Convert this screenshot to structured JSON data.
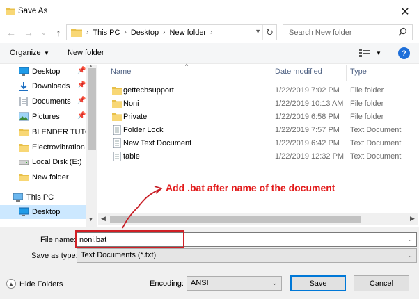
{
  "window": {
    "title": "Save As",
    "close_glyph": "✕"
  },
  "nav": {
    "back_glyph": "←",
    "forward_glyph": "→",
    "recent_glyph": "⌄",
    "up_glyph": "↑",
    "breadcrumb": [
      "This PC",
      "Desktop",
      "New folder"
    ],
    "refresh_glyph": "↻"
  },
  "search": {
    "placeholder": "Search New folder"
  },
  "toolbar": {
    "organize_label": "Organize",
    "new_folder_label": "New folder",
    "help_glyph": "?"
  },
  "sidebar": {
    "items": [
      {
        "label": "Desktop",
        "icon": "desktop-icon",
        "pinned": true
      },
      {
        "label": "Downloads",
        "icon": "download-icon",
        "pinned": true
      },
      {
        "label": "Documents",
        "icon": "document-icon",
        "pinned": true
      },
      {
        "label": "Pictures",
        "icon": "pictures-icon",
        "pinned": true
      },
      {
        "label": "BLENDER TUTOR",
        "icon": "folder-icon",
        "pinned": false
      },
      {
        "label": "Electrovibration",
        "icon": "folder-icon",
        "pinned": false
      },
      {
        "label": "Local Disk (E:)",
        "icon": "drive-icon",
        "pinned": false
      },
      {
        "label": "New folder",
        "icon": "folder-icon",
        "pinned": false
      },
      {
        "label": "This PC",
        "icon": "computer-icon",
        "pinned": false
      },
      {
        "label": "Desktop",
        "icon": "desktop-icon",
        "pinned": false,
        "selected": true
      }
    ]
  },
  "filelist": {
    "columns": [
      "Name",
      "Date modified",
      "Type"
    ],
    "rows": [
      {
        "name": "gettechsupport",
        "date": "1/22/2019 7:02 PM",
        "type": "File folder",
        "icon": "folder-icon"
      },
      {
        "name": "Noni",
        "date": "1/22/2019 10:13 AM",
        "type": "File folder",
        "icon": "folder-icon"
      },
      {
        "name": "Private",
        "date": "1/22/2019 6:58 PM",
        "type": "File folder",
        "icon": "folder-icon"
      },
      {
        "name": "Folder Lock",
        "date": "1/22/2019 7:57 PM",
        "type": "Text Document",
        "icon": "text-document-icon"
      },
      {
        "name": "New Text Document",
        "date": "1/22/2019 6:42 PM",
        "type": "Text Document",
        "icon": "text-document-icon"
      },
      {
        "name": "table",
        "date": "1/22/2019 12:32 PM",
        "type": "Text Document",
        "icon": "text-document-icon"
      }
    ]
  },
  "annotation": {
    "text": "Add .bat after name of the document",
    "color": "#e21b1b"
  },
  "form": {
    "file_name_label": "File name:",
    "file_name_value": "noni.bat",
    "save_type_label": "Save as type:",
    "save_type_value": "Text Documents (*.txt)",
    "encoding_label": "Encoding:",
    "encoding_value": "ANSI",
    "hide_folders_label": "Hide Folders",
    "save_label": "Save",
    "cancel_label": "Cancel"
  },
  "colors": {
    "accent": "#0078d7",
    "selection": "#cce8ff",
    "folder": "#f8d775"
  }
}
